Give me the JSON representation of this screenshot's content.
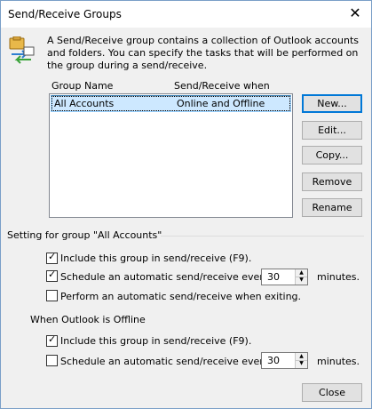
{
  "window": {
    "title": "Send/Receive Groups",
    "close_glyph": "✕"
  },
  "description": "A Send/Receive group contains a collection of Outlook accounts and folders. You can specify the tasks that will be performed on the group during a send/receive.",
  "list": {
    "columns": [
      "Group Name",
      "Send/Receive when"
    ],
    "rows": [
      {
        "name": "All Accounts",
        "when": "Online and Offline",
        "selected": true
      }
    ]
  },
  "buttons": {
    "new": "New...",
    "edit": "Edit...",
    "copy": "Copy...",
    "remove": "Remove",
    "rename": "Rename",
    "close": "Close"
  },
  "online_section": {
    "label": "Setting for group \"All Accounts\"",
    "include": {
      "label": "Include this group in send/receive (F9).",
      "checked": true
    },
    "schedule": {
      "label": "Schedule an automatic send/receive every",
      "checked": true,
      "value": "30",
      "unit": "minutes."
    },
    "on_exit": {
      "label": "Perform an automatic send/receive when exiting.",
      "checked": false
    }
  },
  "offline_section": {
    "label": "When Outlook is Offline",
    "include": {
      "label": "Include this group in send/receive (F9).",
      "checked": true
    },
    "schedule": {
      "label": "Schedule an automatic send/receive every",
      "checked": false,
      "value": "30",
      "unit": "minutes."
    }
  },
  "icons": {
    "app": "send-receive-groups-icon",
    "check": "checkmark-icon"
  }
}
